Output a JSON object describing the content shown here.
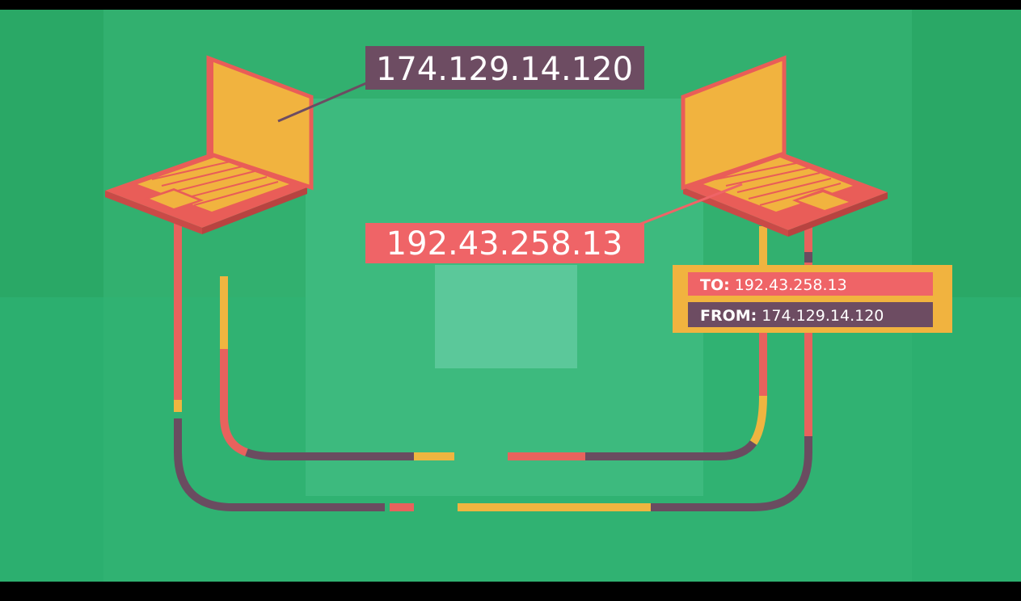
{
  "colors": {
    "background": "#2aa866",
    "panel_light": "#3fbe82",
    "laptop_orange": "#f1b33f",
    "laptop_red": "#e95d58",
    "ip_left_bg": "#6d4c62",
    "ip_right_bg": "#ef6467",
    "cable_purple": "#6a4c60",
    "cable_red": "#e8625d",
    "cable_yellow": "#efb540",
    "packet_border": "#f1b33f",
    "text_white": "#ffffff"
  },
  "left_laptop": {
    "ip": "174.129.14.120"
  },
  "right_laptop": {
    "ip": "192.43.258.13"
  },
  "packet": {
    "to_label": "TO:",
    "to_value": "192.43.258.13",
    "from_label": "FROM:",
    "from_value": "174.129.14.120"
  },
  "icons": [
    "laptop-icon",
    "laptop-icon"
  ]
}
